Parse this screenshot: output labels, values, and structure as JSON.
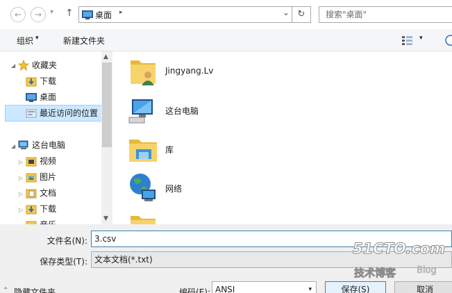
{
  "address_bar": {
    "back_glyph": "←",
    "forward_glyph": "→",
    "recent_glyph": "▾",
    "up_glyph": "↑",
    "path_item": "桌面",
    "path_sep": "▸",
    "dropdown_glyph": "⌄",
    "refresh_glyph": "↻",
    "search_placeholder": "搜索\"桌面\""
  },
  "command_bar": {
    "organize": "组织",
    "organize_caret": "▾",
    "new_folder": "新建文件夹",
    "view_caret": "▾"
  },
  "nav": {
    "favorites": "收藏夹",
    "downloads": "下载",
    "desktop": "桌面",
    "recent": "最近访问的位置",
    "this_pc": "这台电脑",
    "videos": "视频",
    "pictures": "图片",
    "documents": "文档",
    "pc_downloads": "下载",
    "music": "音乐"
  },
  "content": {
    "items": [
      {
        "label": "Jingyang.Lv",
        "icon": "user-folder-icon"
      },
      {
        "label": "这台电脑",
        "icon": "computer-icon"
      },
      {
        "label": "库",
        "icon": "library-icon"
      },
      {
        "label": "网络",
        "icon": "network-icon"
      },
      {
        "label": "",
        "icon": "folder-icon"
      }
    ]
  },
  "form": {
    "filename_label": "文件名(N):",
    "filename_value": "3.csv",
    "filetype_label": "保存类型(T):",
    "filetype_value": "文本文档(*.txt)",
    "hide_folders": "隐藏文件夹",
    "encoding_label": "编码(E):",
    "encoding_value": "ANSI",
    "save": "保存(S)",
    "cancel": "取消"
  },
  "watermark": {
    "line1": "51CTO.com",
    "line2": "技术博客",
    "line3": "Blog"
  },
  "colors": {
    "selection": "#cce8ff",
    "selection_border": "#99d1ff",
    "folder_yellow": "#f4c94f",
    "accent_blue": "#2f6fb5"
  }
}
